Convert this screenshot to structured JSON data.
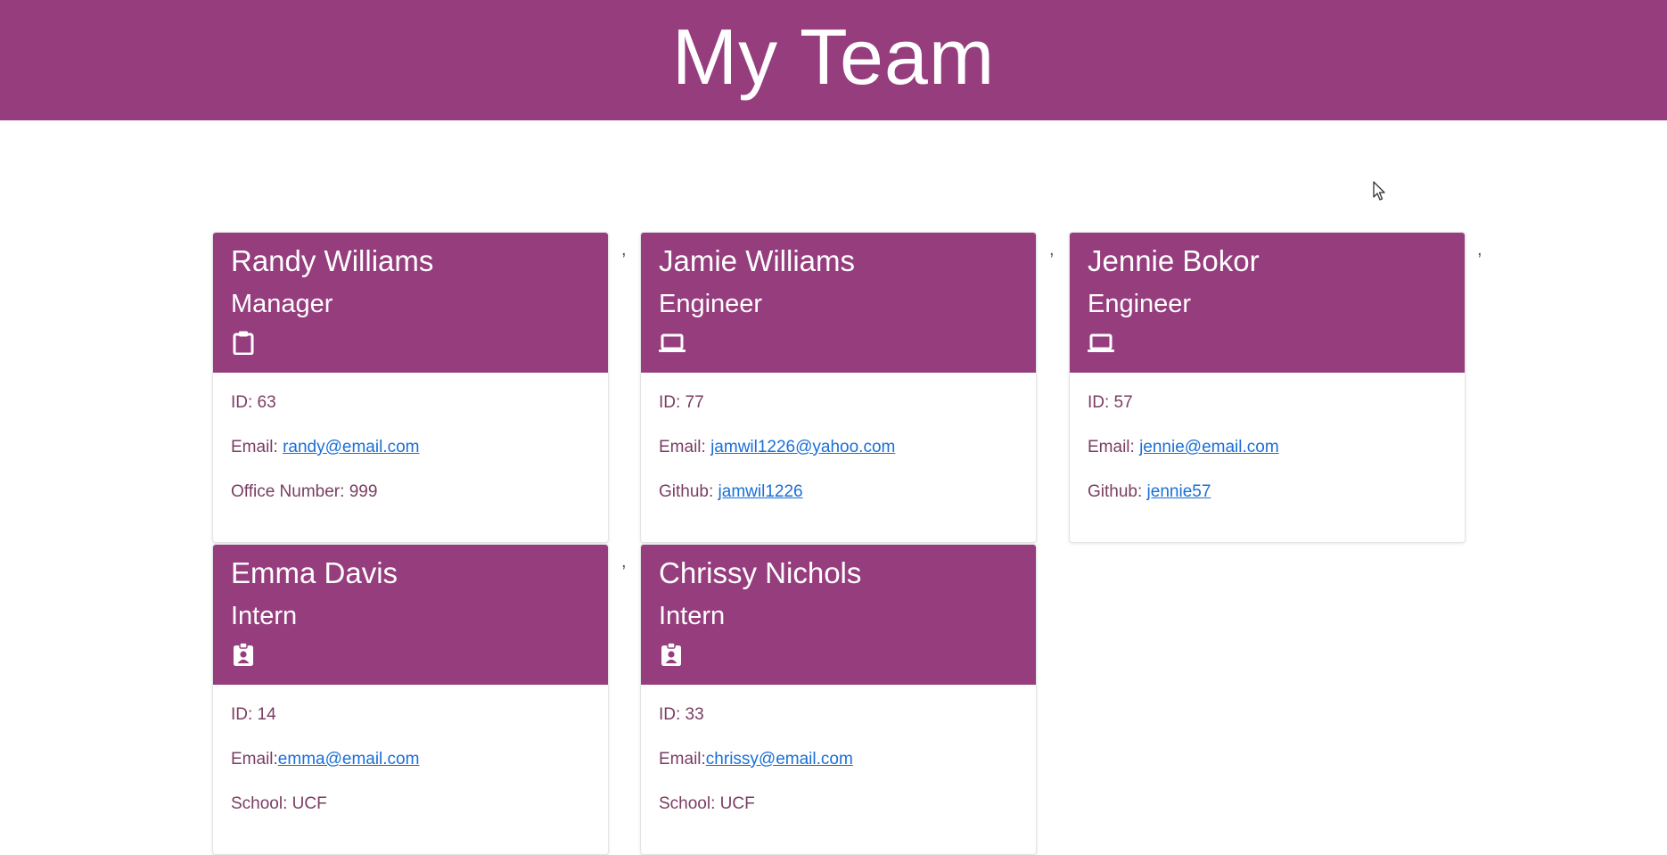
{
  "header": {
    "title": "My Team"
  },
  "colors": {
    "accent": "#963d7e",
    "link": "#1a6fd6",
    "body_text": "#7a3d63"
  },
  "separator": ",",
  "cards": [
    {
      "name": "Randy Williams",
      "role": "Manager",
      "icon": "clipboard-icon",
      "id_line": "ID: 63",
      "email_label": "Email: ",
      "email": "randy@email.com",
      "extra_label": "Office Number: 999",
      "extra_value": ""
    },
    {
      "name": "Jamie Williams",
      "role": "Engineer",
      "icon": "laptop-icon",
      "id_line": "ID: 77",
      "email_label": "Email: ",
      "email": "jamwil1226@yahoo.com",
      "extra_label": "Github: ",
      "extra_value": "jamwil1226"
    },
    {
      "name": "Jennie Bokor",
      "role": "Engineer",
      "icon": "laptop-icon",
      "id_line": "ID: 57",
      "email_label": "Email: ",
      "email": "jennie@email.com",
      "extra_label": "Github: ",
      "extra_value": "jennie57"
    },
    {
      "name": "Emma Davis",
      "role": "Intern",
      "icon": "id-badge-icon",
      "id_line": "ID: 14",
      "email_label": "Email:",
      "email": "emma@email.com",
      "extra_label": "School: UCF",
      "extra_value": ""
    },
    {
      "name": "Chrissy Nichols",
      "role": "Intern",
      "icon": "id-badge-icon",
      "id_line": "ID: 33",
      "email_label": "Email:",
      "email": "chrissy@email.com",
      "extra_label": "School: UCF",
      "extra_value": ""
    }
  ]
}
